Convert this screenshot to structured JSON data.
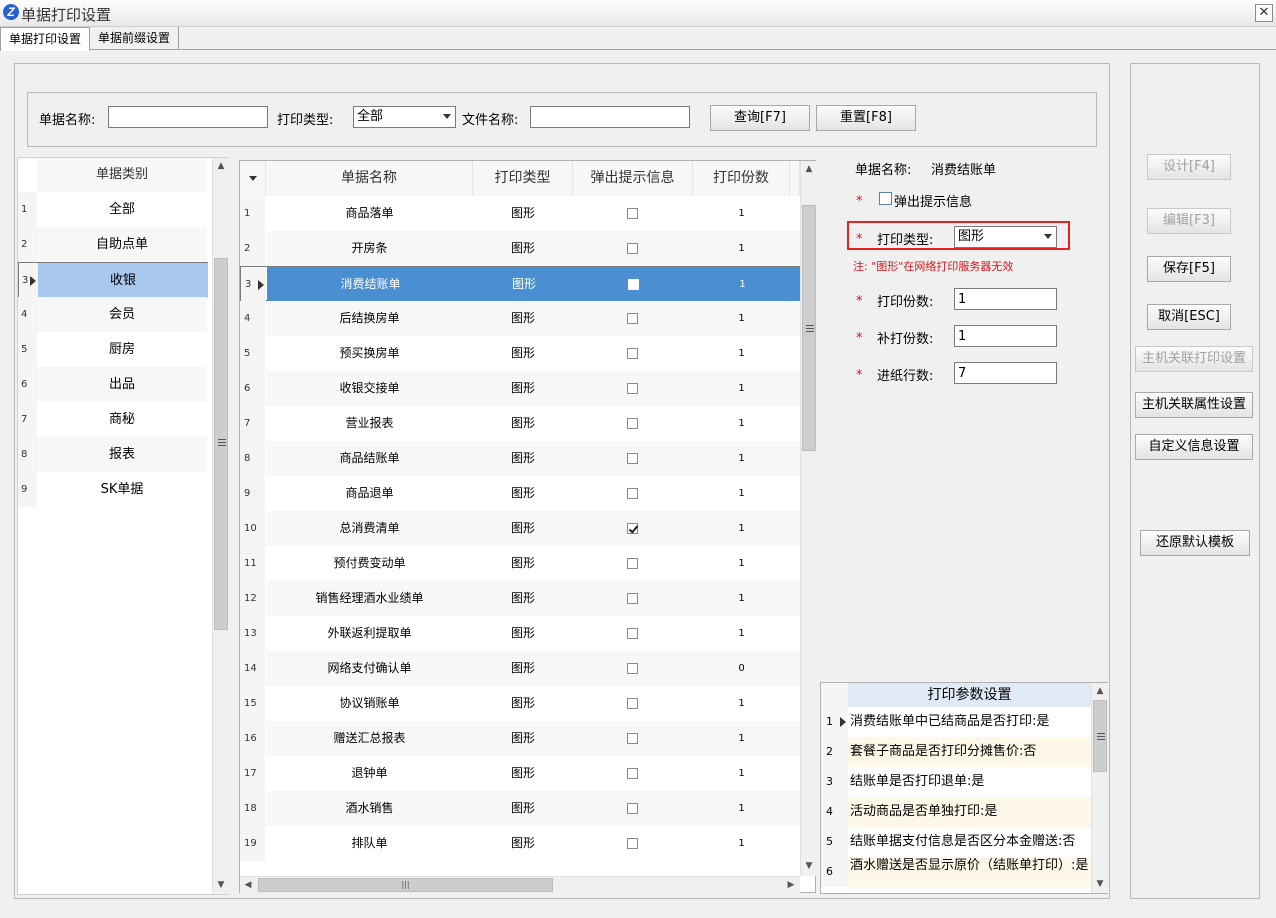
{
  "window": {
    "title": "单据打印设置",
    "close": "✕"
  },
  "tabs": [
    "单据打印设置",
    "单据前缀设置"
  ],
  "search": {
    "name_label": "单据名称:",
    "name_value": "",
    "type_label": "打印类型:",
    "type_value": "全部",
    "file_label": "文件名称:",
    "file_value": "",
    "query_btn": "查询[F7]",
    "reset_btn": "重置[F8]"
  },
  "categories": {
    "header": "单据类别",
    "rows": [
      {
        "num": "1",
        "label": "全部"
      },
      {
        "num": "2",
        "label": "自助点单"
      },
      {
        "num": "3",
        "label": "收银"
      },
      {
        "num": "4",
        "label": "会员"
      },
      {
        "num": "5",
        "label": "厨房"
      },
      {
        "num": "6",
        "label": "出品"
      },
      {
        "num": "7",
        "label": "商秘"
      },
      {
        "num": "8",
        "label": "报表"
      },
      {
        "num": "9",
        "label": "SK单据"
      }
    ],
    "selected_index": 2
  },
  "grid": {
    "headers": [
      "单据名称",
      "打印类型",
      "弹出提示信息",
      "打印份数"
    ],
    "selected_index": 2,
    "rows": [
      {
        "num": "1",
        "name": "商品落单",
        "type": "图形",
        "popup": false,
        "copies": "1"
      },
      {
        "num": "2",
        "name": "开房条",
        "type": "图形",
        "popup": false,
        "copies": "1"
      },
      {
        "num": "3",
        "name": "消费结账单",
        "type": "图形",
        "popup": false,
        "copies": "1"
      },
      {
        "num": "4",
        "name": "后结换房单",
        "type": "图形",
        "popup": false,
        "copies": "1"
      },
      {
        "num": "5",
        "name": "预买换房单",
        "type": "图形",
        "popup": false,
        "copies": "1"
      },
      {
        "num": "6",
        "name": "收银交接单",
        "type": "图形",
        "popup": false,
        "copies": "1"
      },
      {
        "num": "7",
        "name": "营业报表",
        "type": "图形",
        "popup": false,
        "copies": "1"
      },
      {
        "num": "8",
        "name": "商品结账单",
        "type": "图形",
        "popup": false,
        "copies": "1"
      },
      {
        "num": "9",
        "name": "商品退单",
        "type": "图形",
        "popup": false,
        "copies": "1"
      },
      {
        "num": "10",
        "name": "总消费清单",
        "type": "图形",
        "popup": true,
        "copies": "1"
      },
      {
        "num": "11",
        "name": "预付费变动单",
        "type": "图形",
        "popup": false,
        "copies": "1"
      },
      {
        "num": "12",
        "name": "销售经理酒水业绩单",
        "type": "图形",
        "popup": false,
        "copies": "1"
      },
      {
        "num": "13",
        "name": "外联返利提取单",
        "type": "图形",
        "popup": false,
        "copies": "1"
      },
      {
        "num": "14",
        "name": "网络支付确认单",
        "type": "图形",
        "popup": false,
        "copies": "0"
      },
      {
        "num": "15",
        "name": "协议销账单",
        "type": "图形",
        "popup": false,
        "copies": "1"
      },
      {
        "num": "16",
        "name": "赠送汇总报表",
        "type": "图形",
        "popup": false,
        "copies": "1"
      },
      {
        "num": "17",
        "name": "退钟单",
        "type": "图形",
        "popup": false,
        "copies": "1"
      },
      {
        "num": "18",
        "name": "酒水销售",
        "type": "图形",
        "popup": false,
        "copies": "1"
      },
      {
        "num": "19",
        "name": "排队单",
        "type": "图形",
        "popup": false,
        "copies": "1"
      }
    ]
  },
  "detail": {
    "name_label": "单据名称:",
    "name_value": "消费结账单",
    "star": "*",
    "popup_label": "弹出提示信息",
    "type_label": "打印类型:",
    "type_value": "图形",
    "note": "注: \"图形\"在网络打印服务器无效",
    "copies_label": "打印份数:",
    "copies_value": "1",
    "reprint_label": "补打份数:",
    "reprint_value": "1",
    "feed_label": "进纸行数:",
    "feed_value": "7"
  },
  "params": {
    "header": "打印参数设置",
    "rows": [
      {
        "num": "1",
        "text": "消费结账单中已结商品是否打印:是"
      },
      {
        "num": "2",
        "text": "套餐子商品是否打印分摊售价:否"
      },
      {
        "num": "3",
        "text": "结账单是否打印退单:是"
      },
      {
        "num": "4",
        "text": "活动商品是否单独打印:是"
      },
      {
        "num": "5",
        "text": "结账单据支付信息是否区分本金赠送:否"
      },
      {
        "num": "6",
        "text": "酒水赠送是否显示原价（结账单打印）:是"
      }
    ]
  },
  "actions": {
    "design": "设计[F4]",
    "edit": "编辑[F3]",
    "save": "保存[F5]",
    "cancel": "取消[ESC]",
    "host_print": "主机关联打印设置",
    "host_attr": "主机关联属性设置",
    "custom_info": "自定义信息设置",
    "restore": "还原默认模板"
  },
  "scrollbar_glyphs": {
    "up": "▲",
    "down": "▼",
    "left": "◀",
    "right": "▶"
  }
}
